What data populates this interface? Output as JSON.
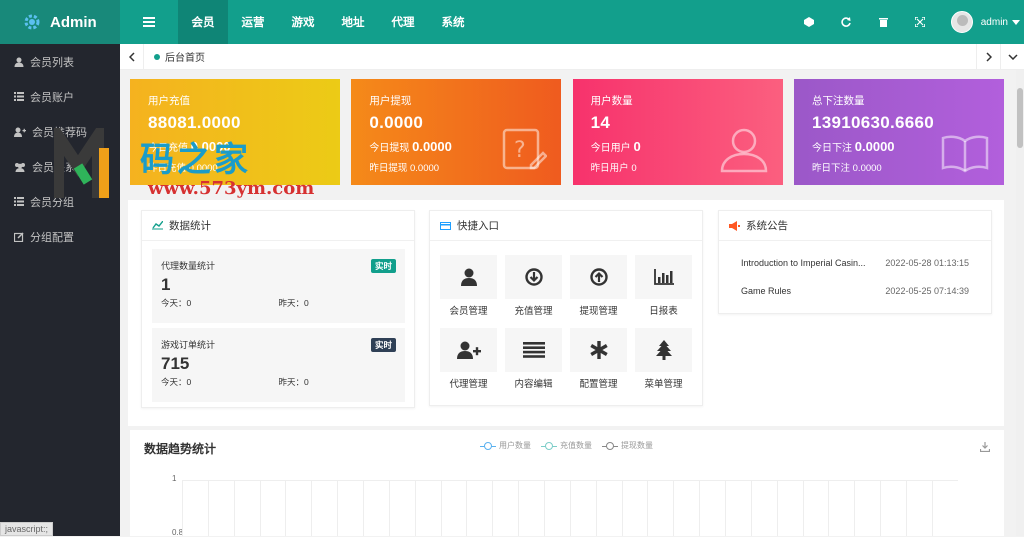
{
  "header": {
    "brand": "Admin",
    "nav": [
      "会员",
      "运营",
      "游戏",
      "地址",
      "代理",
      "系统"
    ],
    "active_nav": 0,
    "user": "admin"
  },
  "sidebar": {
    "items": [
      {
        "label": "会员列表",
        "icon": "user-icon"
      },
      {
        "label": "会员账户",
        "icon": "list-icon"
      },
      {
        "label": "会员推荐码",
        "icon": "user-plus-icon"
      },
      {
        "label": "会员关系",
        "icon": "users-icon"
      },
      {
        "label": "会员分组",
        "icon": "list-icon"
      },
      {
        "label": "分组配置",
        "icon": "edit-icon"
      }
    ]
  },
  "tabs": {
    "home": "后台首页"
  },
  "stats": [
    {
      "title": "用户充值",
      "value": "88081.0000",
      "today_label": "今日充值",
      "today_value": "0.0000",
      "yesterday_label": "昨日充值",
      "yesterday_value": "0.0000",
      "icon": "wallet-icon"
    },
    {
      "title": "用户提现",
      "value": "0.0000",
      "today_label": "今日提现",
      "today_value": "0.0000",
      "yesterday_label": "昨日提现",
      "yesterday_value": "0.0000",
      "icon": "question-edit-icon"
    },
    {
      "title": "用户数量",
      "value": "14",
      "today_label": "今日用户",
      "today_value": "0",
      "yesterday_label": "昨日用户",
      "yesterday_value": "0",
      "icon": "users-outline-icon"
    },
    {
      "title": "总下注数量",
      "value": "13910630.6660",
      "today_label": "今日下注",
      "today_value": "0.0000",
      "yesterday_label": "昨日下注",
      "yesterday_value": "0.0000",
      "icon": "book-icon"
    }
  ],
  "data_stats": {
    "title": "数据统计",
    "items": [
      {
        "label": "代理数量统计",
        "badge": "实时",
        "badge_color": "#129f8c",
        "value": "1",
        "today": "今天：0",
        "yesterday": "昨天：0"
      },
      {
        "label": "游戏订单统计",
        "badge": "实时",
        "badge_color": "#2f4056",
        "value": "715",
        "today": "今天：0",
        "yesterday": "昨天：0"
      }
    ]
  },
  "quick": {
    "title": "快捷入口",
    "items": [
      {
        "label": "会员管理",
        "icon": "user-solid-icon"
      },
      {
        "label": "充值管理",
        "icon": "arrow-down-circle-icon"
      },
      {
        "label": "提现管理",
        "icon": "arrow-up-circle-icon"
      },
      {
        "label": "日报表",
        "icon": "bar-chart-icon"
      },
      {
        "label": "代理管理",
        "icon": "user-add-icon"
      },
      {
        "label": "内容编辑",
        "icon": "lines-icon"
      },
      {
        "label": "配置管理",
        "icon": "asterisk-icon"
      },
      {
        "label": "菜单管理",
        "icon": "tree-icon"
      }
    ]
  },
  "notices": {
    "title": "系统公告",
    "items": [
      {
        "title": "Introduction to Imperial Casin...",
        "date": "2022-05-28 01:13:15"
      },
      {
        "title": "Game Rules",
        "date": "2022-05-25 07:14:39"
      }
    ]
  },
  "trend": {
    "title": "数据趋势统计",
    "legend": [
      "用户数量",
      "充值数量",
      "提现数量"
    ],
    "y_ticks": [
      "1",
      "0.8"
    ]
  },
  "watermark": {
    "brand": "码之家",
    "url": "www.573ym.com"
  },
  "statusbar": "javascript:;",
  "colors": {
    "primary": "#129f8c",
    "sidebar": "#23262e"
  }
}
